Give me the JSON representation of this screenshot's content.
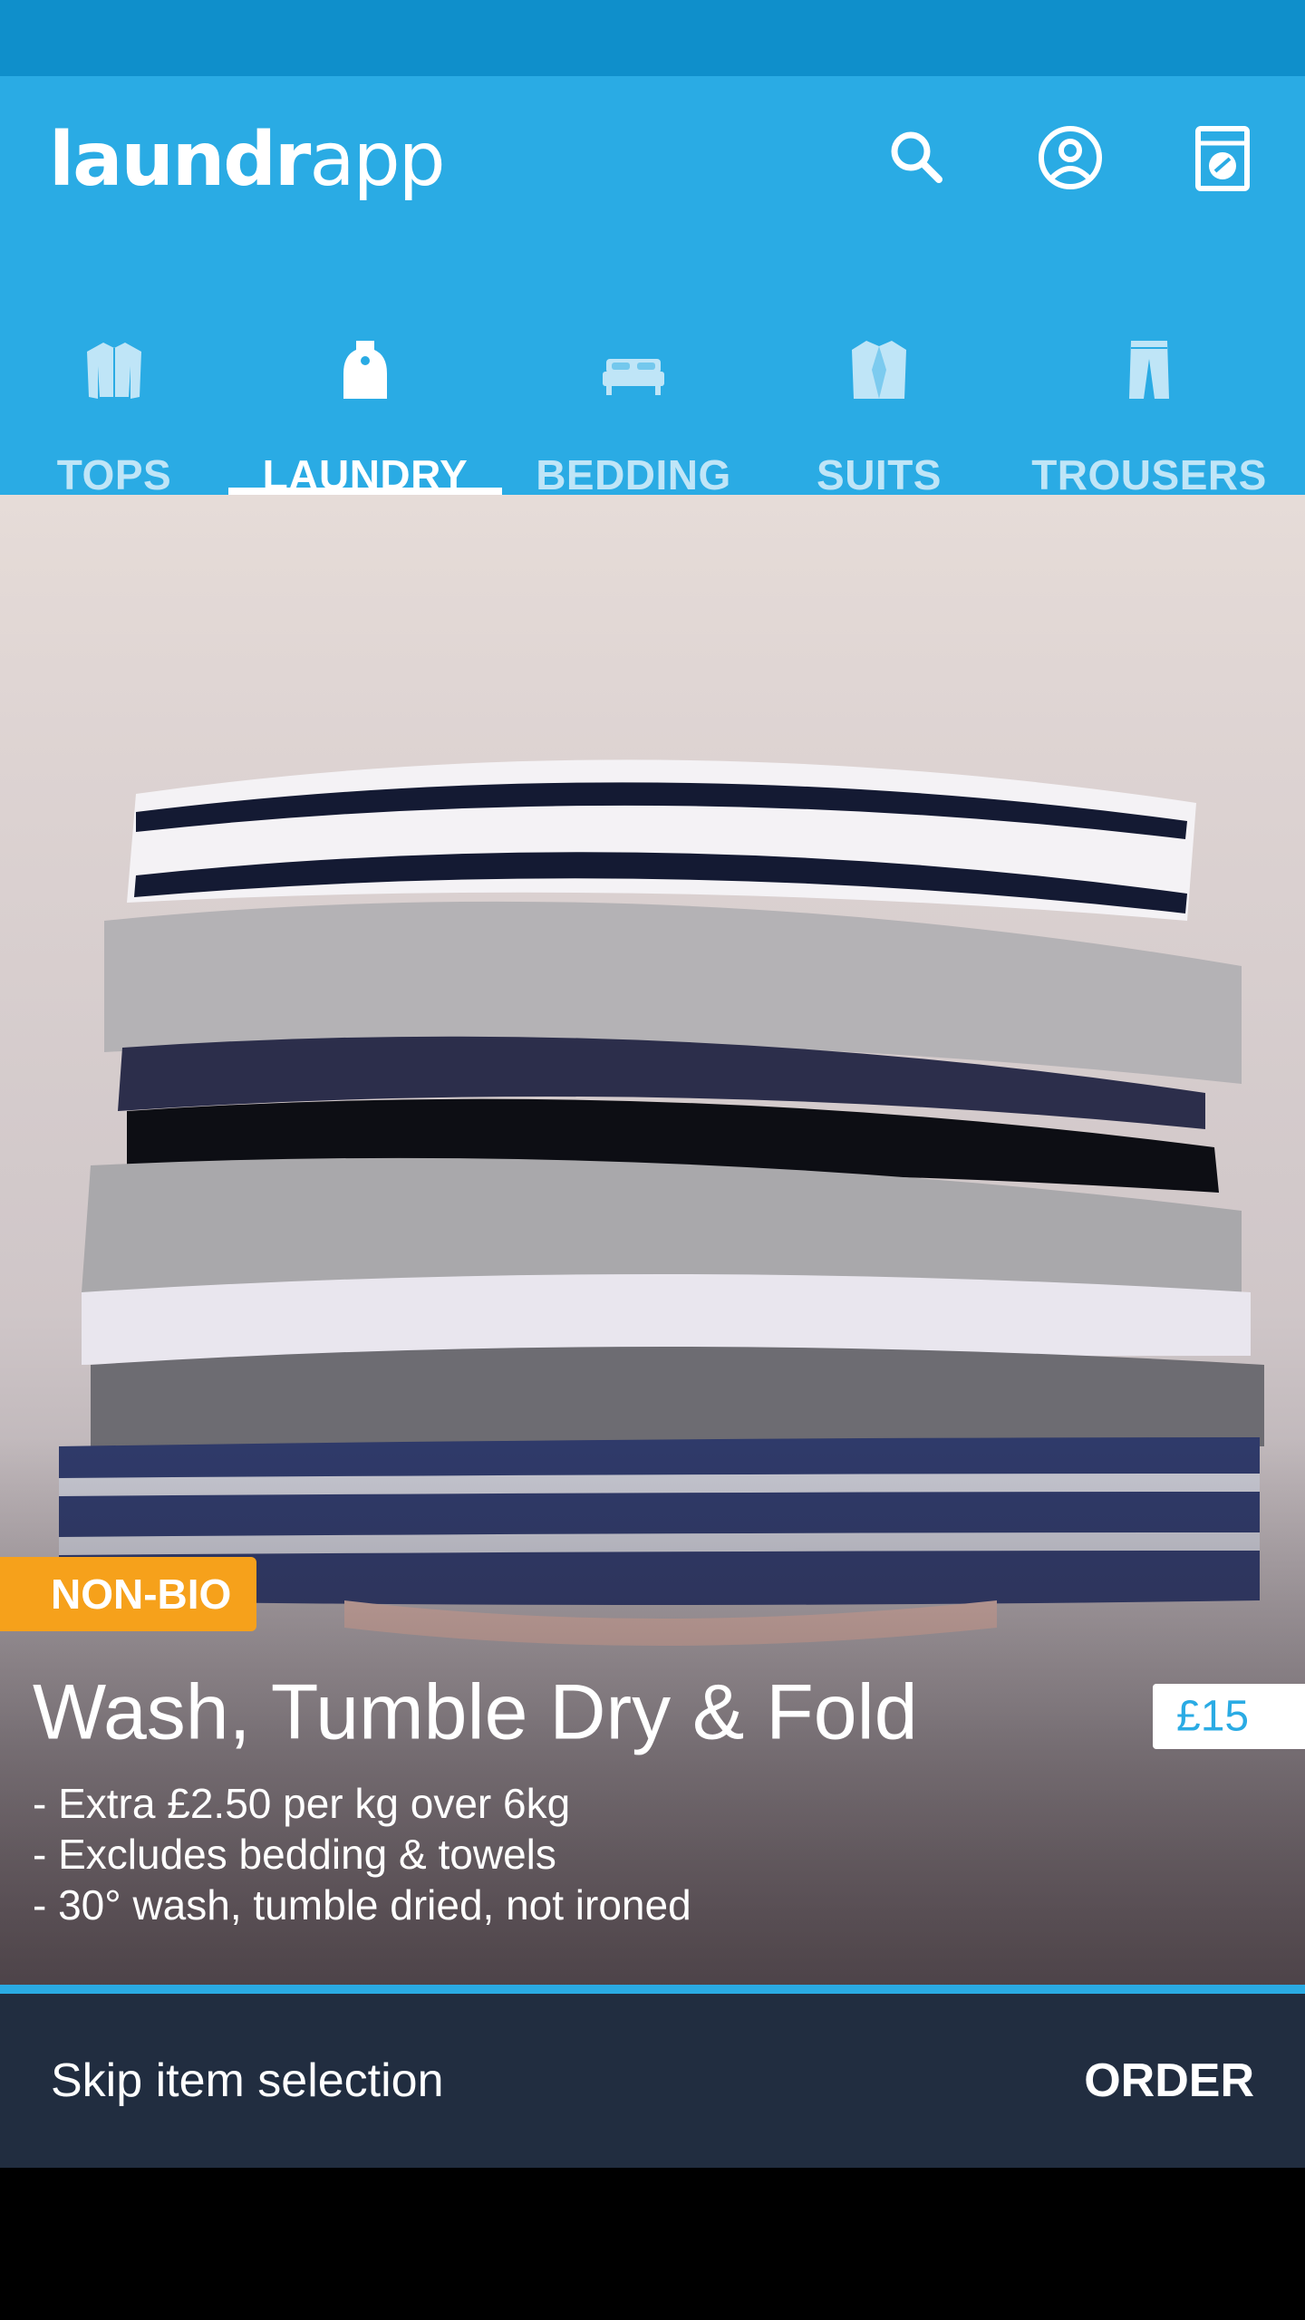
{
  "app": {
    "logo_bold": "laundr",
    "logo_light": "app"
  },
  "header": {
    "icons": [
      "search-icon",
      "account-icon",
      "washing-machine-icon"
    ],
    "color": "#2aabe4",
    "status_color": "#0f8fcb"
  },
  "tabs": [
    {
      "label": "TOPS",
      "icon": "shirt-icon"
    },
    {
      "label": "LAUNDRY",
      "icon": "laundry-bag-icon",
      "active": true
    },
    {
      "label": "BEDDING",
      "icon": "bed-icon"
    },
    {
      "label": "SUITS",
      "icon": "suit-jacket-icon"
    },
    {
      "label": "TROUSERS",
      "icon": "trousers-icon"
    }
  ],
  "product": {
    "badge": "NON-BIO",
    "title": "Wash, Tumble Dry & Fold",
    "price": "£15",
    "details": [
      "- Extra £2.50 per kg over 6kg",
      "- Excludes bedding & towels",
      "- 30° wash, tumble dried, not ironed"
    ],
    "badge_color": "#f6a11b"
  },
  "footer": {
    "skip_label": "Skip item selection",
    "order_label": "ORDER",
    "color": "#212d40"
  }
}
